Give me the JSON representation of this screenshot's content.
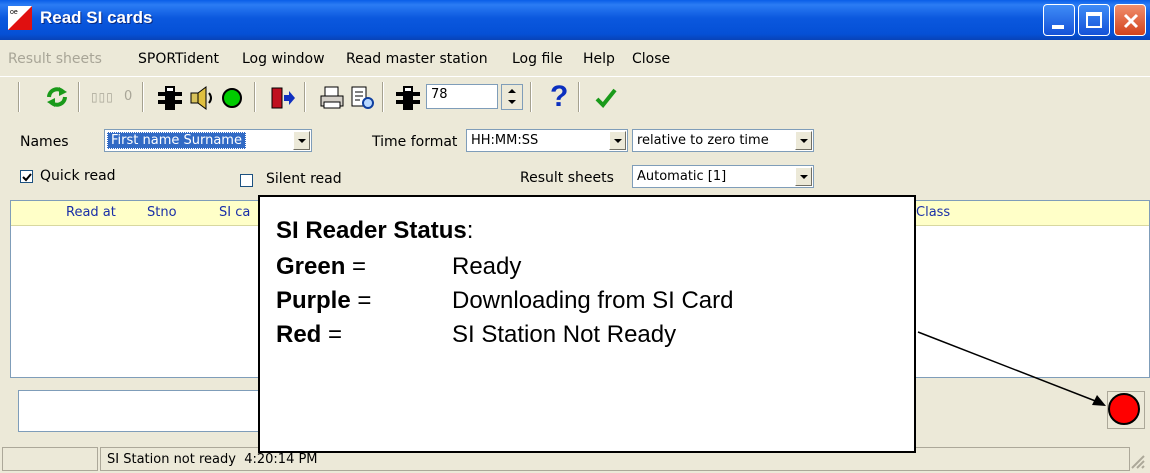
{
  "window": {
    "title": "Read SI cards",
    "icon": "oe-flag-icon",
    "controls": [
      "minimize-icon",
      "maximize-icon",
      "close-icon"
    ]
  },
  "menu": {
    "items": [
      "Result sheets",
      "SPORTident",
      "Log window",
      "Read master station",
      "Log file",
      "Help",
      "Close"
    ],
    "disabled": [
      "Result sheets"
    ]
  },
  "toolbar": {
    "counter_label": "0",
    "spinner_value": "78",
    "icons": [
      "refresh-icon",
      "counter-icon",
      "station-icon",
      "sound-icon",
      "green-status-icon",
      "exit-door-icon",
      "print-icon",
      "preview-icon",
      "station-icon",
      "help-icon",
      "check-icon"
    ]
  },
  "form": {
    "names_label": "Names",
    "names_value": "First name Surname",
    "time_format_label": "Time format",
    "time_format_value": "HH:MM:SS",
    "time_relative_value": "relative to zero time",
    "quick_read_label": "Quick read",
    "quick_read_checked": true,
    "silent_read_label": "Silent read",
    "silent_read_checked": false,
    "result_sheets_label": "Result sheets",
    "result_sheets_value": "Automatic [1]"
  },
  "list": {
    "columns": [
      "Read at",
      "Stno",
      "SI ca",
      "Class"
    ]
  },
  "statusbar": {
    "text": "SI Station not ready  4:20:14 PM"
  },
  "status_led_color": "#ff0000",
  "callout": {
    "title": "SI Reader Status",
    "title_suffix": ":",
    "rows": [
      {
        "key": "Green",
        "eq": " =",
        "value": "Ready"
      },
      {
        "key": "Purple",
        "eq": " =",
        "value": "Downloading from SI Card"
      },
      {
        "key": "Red",
        "eq": " =",
        "value": "SI Station Not Ready"
      }
    ]
  }
}
